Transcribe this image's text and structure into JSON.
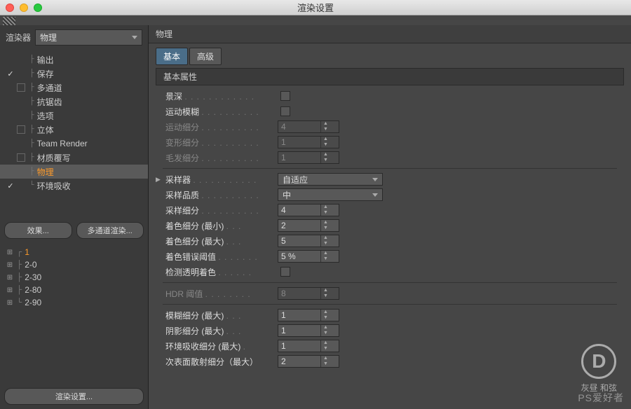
{
  "window": {
    "title": "渲染设置"
  },
  "sidebar": {
    "renderer_label": "渲染器",
    "renderer_value": "物理",
    "items": [
      {
        "label": "输出",
        "checked": false,
        "box": false
      },
      {
        "label": "保存",
        "checked": true,
        "box": false
      },
      {
        "label": "多通道",
        "checked": false,
        "box": true
      },
      {
        "label": "抗锯齿",
        "checked": false,
        "box": false
      },
      {
        "label": "选项",
        "checked": false,
        "box": false
      },
      {
        "label": "立体",
        "checked": false,
        "box": true
      },
      {
        "label": "Team Render",
        "checked": false,
        "box": false
      },
      {
        "label": "材质覆写",
        "checked": false,
        "box": true
      },
      {
        "label": "物理",
        "checked": false,
        "box": false,
        "selected": true
      },
      {
        "label": "环境吸收",
        "checked": true,
        "box": false
      }
    ],
    "btn_effects": "效果...",
    "btn_multipass": "多通道渲染...",
    "presets": [
      {
        "label": "1",
        "selected": true
      },
      {
        "label": "2-0"
      },
      {
        "label": "2-30"
      },
      {
        "label": "2-80"
      },
      {
        "label": "2-90"
      }
    ],
    "btn_render_settings": "渲染设置..."
  },
  "content": {
    "header": "物理",
    "tabs": {
      "basic": "基本",
      "advanced": "高级"
    },
    "section": "基本属性",
    "props": {
      "dof": {
        "label": "景深"
      },
      "motion_blur": {
        "label": "运动模糊"
      },
      "motion_sub": {
        "label": "运动细分",
        "value": "4"
      },
      "deform_sub": {
        "label": "变形细分",
        "value": "1"
      },
      "hair_sub": {
        "label": "毛发细分",
        "value": "1"
      },
      "sampler": {
        "label": "采样器",
        "value": "自适应"
      },
      "sample_quality": {
        "label": "采样品质",
        "value": "中"
      },
      "sample_sub": {
        "label": "采样细分",
        "value": "4"
      },
      "shade_min": {
        "label": "着色细分 (最小)",
        "value": "2"
      },
      "shade_max": {
        "label": "着色细分 (最大)",
        "value": "5"
      },
      "shade_err": {
        "label": "着色错误阈值",
        "value": "5 %"
      },
      "detect_trans": {
        "label": "检测透明着色"
      },
      "hdr_thresh": {
        "label": "HDR 阈值",
        "value": "8"
      },
      "blur_max": {
        "label": "模糊细分 (最大)",
        "value": "1"
      },
      "shadow_max": {
        "label": "阴影细分 (最大)",
        "value": "1"
      },
      "ao_max": {
        "label": "环境吸收细分 (最大)",
        "value": "1"
      },
      "sss_max": {
        "label": "次表面散射细分（最大）",
        "value": "2"
      }
    }
  },
  "watermark": {
    "letter": "D",
    "text1": "灰昼 和弦",
    "text2": "PS爱好者"
  }
}
